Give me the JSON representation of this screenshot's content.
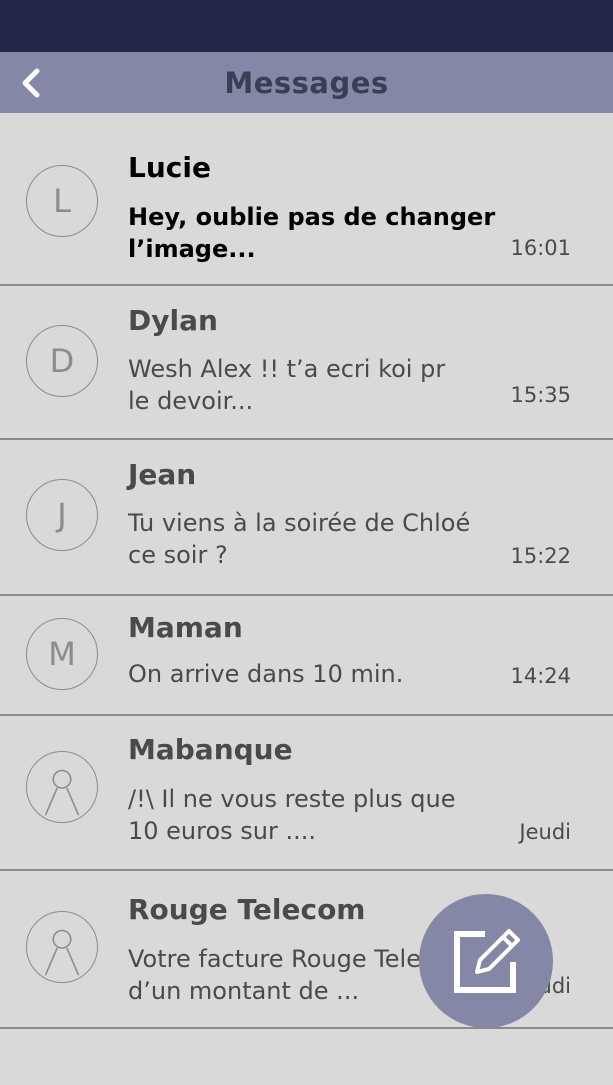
{
  "header": {
    "title": "Messages",
    "back_icon": "chevron-left-icon"
  },
  "conversations": [
    {
      "initial": "L",
      "name": "Lucie",
      "preview": "Hey, oublie pas de changer l’image...",
      "time": "16:01",
      "unread": true
    },
    {
      "initial": "D",
      "name": "Dylan",
      "preview": "Wesh Alex !! t’a ecri koi pr le devoir...",
      "time": "15:35",
      "unread": false
    },
    {
      "initial": "J",
      "name": "Jean",
      "preview": "Tu viens à la soirée de Chloé ce soir ?",
      "time": "15:22",
      "unread": false
    },
    {
      "initial": "M",
      "name": "Maman",
      "preview": "On arrive dans 10 min.",
      "time": "14:24",
      "unread": false
    },
    {
      "initial": "",
      "name": "Mabanque",
      "preview": "/!\\ Il ne vous reste plus que 10 euros sur ....",
      "time": "Jeudi",
      "unread": false,
      "avatar_icon": "person-icon"
    },
    {
      "initial": "",
      "name": "Rouge Telecom",
      "preview": "Votre facture Rouge Telecom d’un montant de ...",
      "time": "Jeudi",
      "unread": false,
      "avatar_icon": "person-icon"
    }
  ],
  "fab": {
    "icon": "compose-icon"
  },
  "colors": {
    "status_bar": "#22244a",
    "header": "#8487a5",
    "background": "#d9d9d9",
    "divider": "#8a8a8a"
  }
}
